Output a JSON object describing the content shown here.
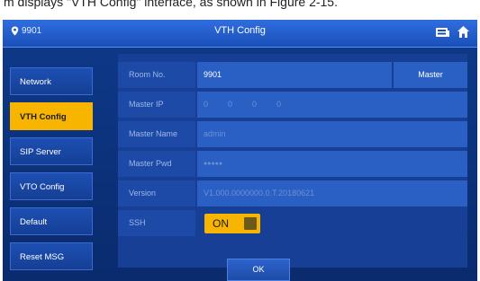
{
  "doc_caption": "m displays \"VTH Config\" interface, as shown in Figure 2-15.",
  "header": {
    "location": "9901",
    "title": "VTH Config",
    "icons": [
      "location-pin-icon",
      "message-icon",
      "home-icon"
    ]
  },
  "sidebar": {
    "items": [
      {
        "label": "Network",
        "active": false
      },
      {
        "label": "VTH Config",
        "active": true
      },
      {
        "label": "SIP Server",
        "active": false
      },
      {
        "label": "VTO Config",
        "active": false
      },
      {
        "label": "Default",
        "active": false
      },
      {
        "label": "Reset MSG",
        "active": false
      }
    ]
  },
  "form": {
    "room_no": {
      "label": "Room No.",
      "value": "9901"
    },
    "master_button": "Master",
    "master_ip": {
      "label": "Master IP",
      "octets": [
        "0",
        "0",
        "0",
        "0"
      ]
    },
    "master_name": {
      "label": "Master Name",
      "value": "admin"
    },
    "master_pwd": {
      "label": "Master Pwd",
      "value": "●●●●●"
    },
    "version": {
      "label": "Version",
      "value": "V1.000.0000000.0.T.20180621"
    },
    "ssh": {
      "label": "SSH",
      "state": "ON"
    }
  },
  "ok_button": "OK",
  "colors": {
    "accent": "#f7b500",
    "panel": "#173f96",
    "field": "#2a5fc4"
  }
}
